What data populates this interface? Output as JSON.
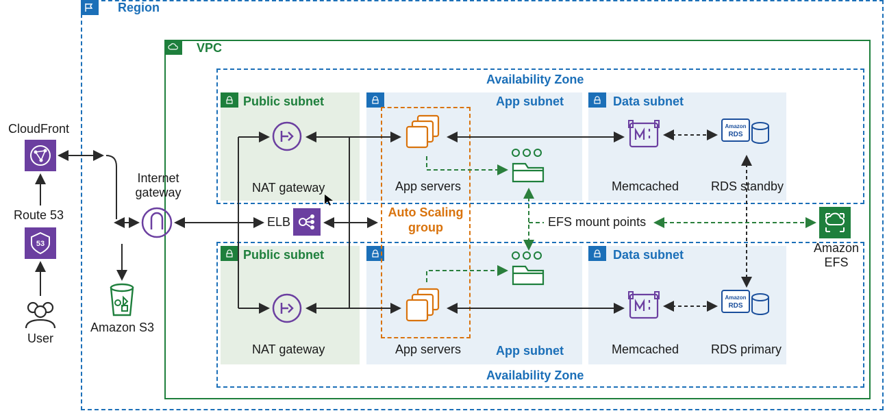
{
  "region": {
    "label": "Region"
  },
  "vpc": {
    "label": "VPC"
  },
  "az_top": {
    "label": "Availability Zone"
  },
  "az_bottom": {
    "label": "Availability Zone"
  },
  "public_subnet": {
    "label": "Public subnet"
  },
  "app_subnet": {
    "label": "App subnet"
  },
  "data_subnet": {
    "label": "Data subnet"
  },
  "nat_gateway": {
    "label": "NAT gateway"
  },
  "app_servers": {
    "label": "App servers"
  },
  "memcached": {
    "label": "Memcached"
  },
  "rds_standby": {
    "label": "RDS standby"
  },
  "rds_primary": {
    "label": "RDS primary"
  },
  "asg": {
    "label": "Auto Scaling group"
  },
  "elb": {
    "label": "ELB"
  },
  "efs_mount": {
    "label": "EFS mount points"
  },
  "amazon_efs": {
    "label": "Amazon EFS"
  },
  "internet_gateway": {
    "label": "Internet gateway"
  },
  "amazon_s3": {
    "label": "Amazon S3"
  },
  "cloudfront": {
    "label": "CloudFront"
  },
  "route53": {
    "label": "Route 53"
  },
  "user": {
    "label": "User"
  },
  "rds_badge": {
    "label": "Amazon RDS"
  }
}
